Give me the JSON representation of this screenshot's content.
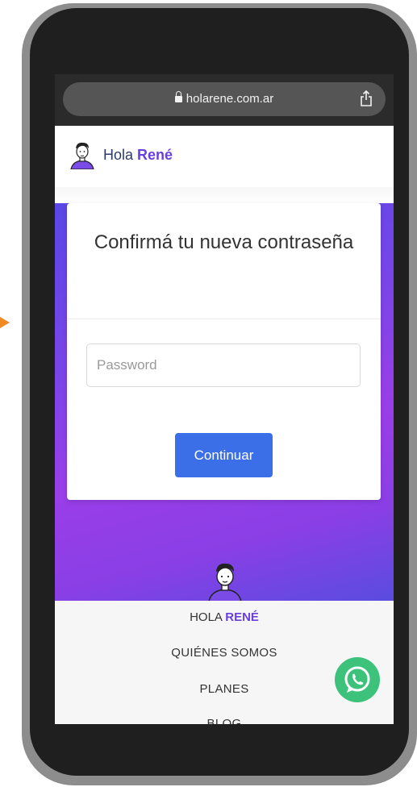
{
  "browser": {
    "url": "holarene.com.ar"
  },
  "header": {
    "brand_prefix": "Hola ",
    "brand_accent": "René"
  },
  "card": {
    "title": "Confirmá tu nueva contraseña",
    "password_placeholder": "Password",
    "password_value": "",
    "continue_label": "Continuar"
  },
  "footer": {
    "brand_prefix": "HOLA ",
    "brand_accent": "RENÉ",
    "nav": [
      "QUIÉNES SOMOS",
      "PLANES",
      "BLOG"
    ]
  },
  "colors": {
    "primary_button": "#3b6fe8",
    "accent": "#6a3fe0",
    "whatsapp": "#3cc27a",
    "arrow": "#f08a24"
  },
  "icons": [
    "lock-icon",
    "share-icon",
    "logo-icon",
    "whatsapp-icon",
    "arrow-icon"
  ]
}
